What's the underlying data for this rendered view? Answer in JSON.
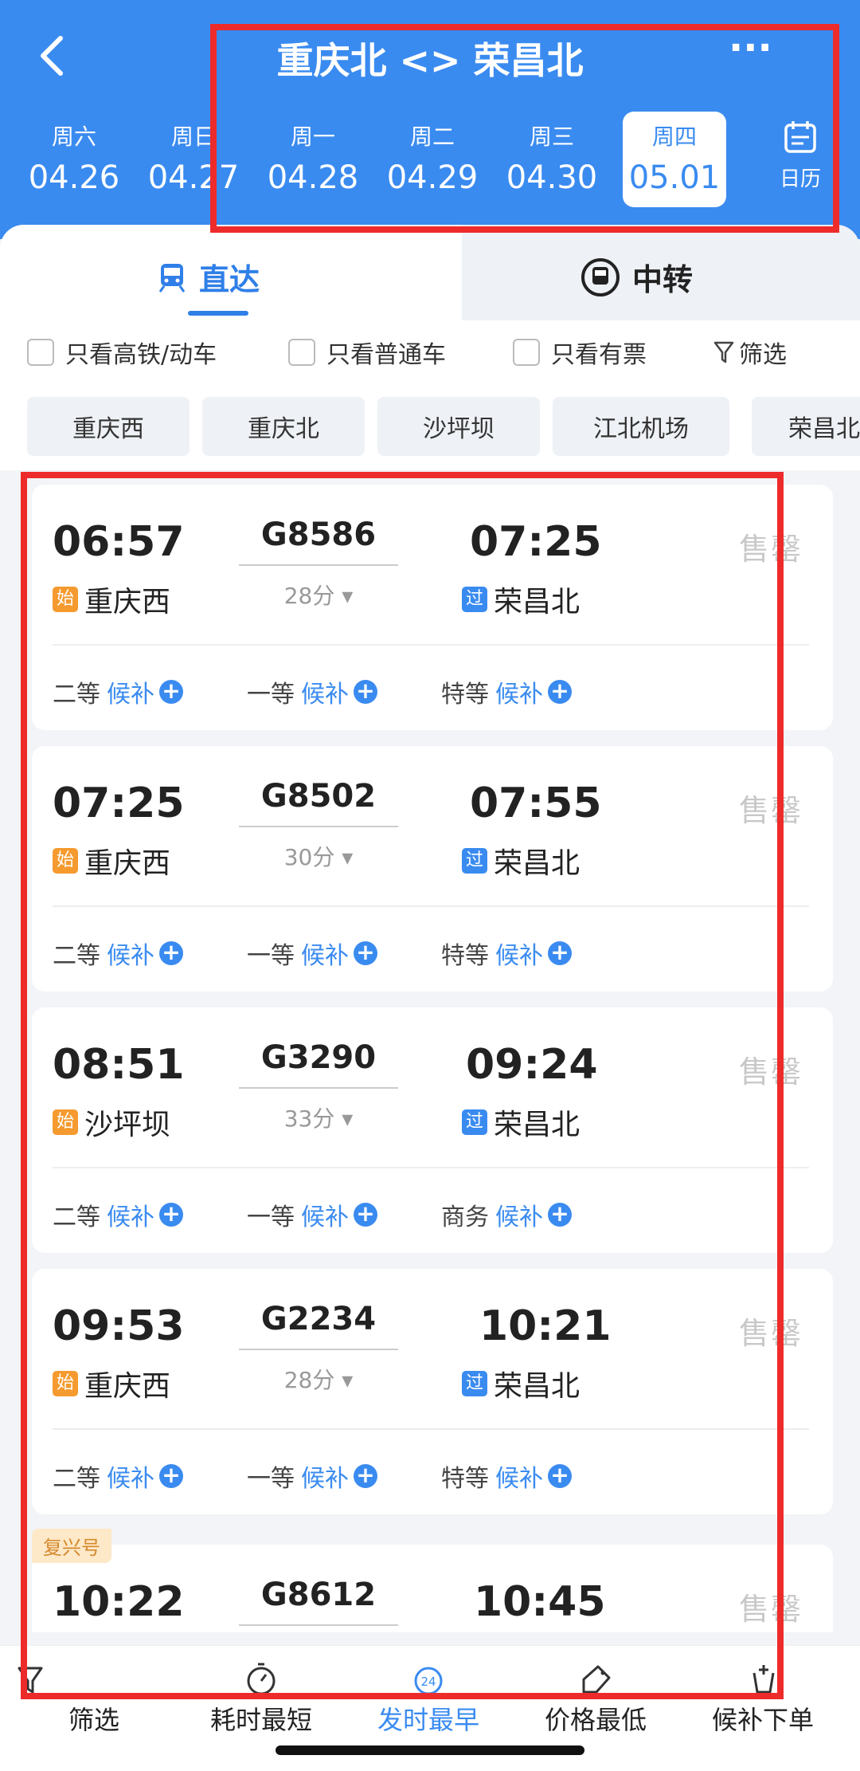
{
  "header": {
    "title": "重庆北 <> 荣昌北",
    "more": "···",
    "dates": [
      {
        "weekday": "周六",
        "date": "04.26"
      },
      {
        "weekday": "周日",
        "date": "04.27"
      },
      {
        "weekday": "周一",
        "date": "04.28"
      },
      {
        "weekday": "周二",
        "date": "04.29"
      },
      {
        "weekday": "周三",
        "date": "04.30"
      },
      {
        "weekday": "周四",
        "date": "05.01"
      }
    ],
    "calendar_label": "日历"
  },
  "tabs": {
    "direct": "直达",
    "transfer": "中转"
  },
  "filters": {
    "high_speed": "只看高铁/动车",
    "ordinary": "只看普通车",
    "available": "只看有票",
    "filter": "筛选"
  },
  "stations": [
    "重庆西",
    "重庆北",
    "沙坪坝",
    "江北机场",
    "荣昌北"
  ],
  "trains": [
    {
      "dep": "06:57",
      "train": "G8586",
      "arr": "07:25",
      "duration": "28分",
      "from_tag": "始",
      "from": "重庆西",
      "to_tag": "过",
      "to": "荣昌北",
      "status": "售罄",
      "seats": [
        {
          "cls": "二等",
          "state": "候补"
        },
        {
          "cls": "一等",
          "state": "候补"
        },
        {
          "cls": "特等",
          "state": "候补"
        }
      ]
    },
    {
      "dep": "07:25",
      "train": "G8502",
      "arr": "07:55",
      "duration": "30分",
      "from_tag": "始",
      "from": "重庆西",
      "to_tag": "过",
      "to": "荣昌北",
      "status": "售罄",
      "seats": [
        {
          "cls": "二等",
          "state": "候补"
        },
        {
          "cls": "一等",
          "state": "候补"
        },
        {
          "cls": "特等",
          "state": "候补"
        }
      ]
    },
    {
      "dep": "08:51",
      "train": "G3290",
      "arr": "09:24",
      "duration": "33分",
      "from_tag": "始",
      "from": "沙坪坝",
      "to_tag": "过",
      "to": "荣昌北",
      "status": "售罄",
      "seats": [
        {
          "cls": "二等",
          "state": "候补"
        },
        {
          "cls": "一等",
          "state": "候补"
        },
        {
          "cls": "商务",
          "state": "候补"
        }
      ]
    },
    {
      "dep": "09:53",
      "train": "G2234",
      "arr": "10:21",
      "duration": "28分",
      "from_tag": "始",
      "from": "重庆西",
      "to_tag": "过",
      "to": "荣昌北",
      "status": "售罄",
      "seats": [
        {
          "cls": "二等",
          "state": "候补"
        },
        {
          "cls": "一等",
          "state": "候补"
        },
        {
          "cls": "特等",
          "state": "候补"
        }
      ]
    },
    {
      "badge": "复兴号",
      "dep": "10:22",
      "train": "G8612",
      "arr": "10:45",
      "status": "售罄"
    }
  ],
  "bottom": {
    "filter": "筛选",
    "shortest": "耗时最短",
    "earliest": "发时最早",
    "earliest_icon_text": "24",
    "cheapest": "价格最低",
    "waitlist": "候补下单"
  },
  "colors": {
    "primary": "#3a8bf0",
    "highlight_box": "#ee2b2b",
    "start_tag": "#f59a2e"
  }
}
